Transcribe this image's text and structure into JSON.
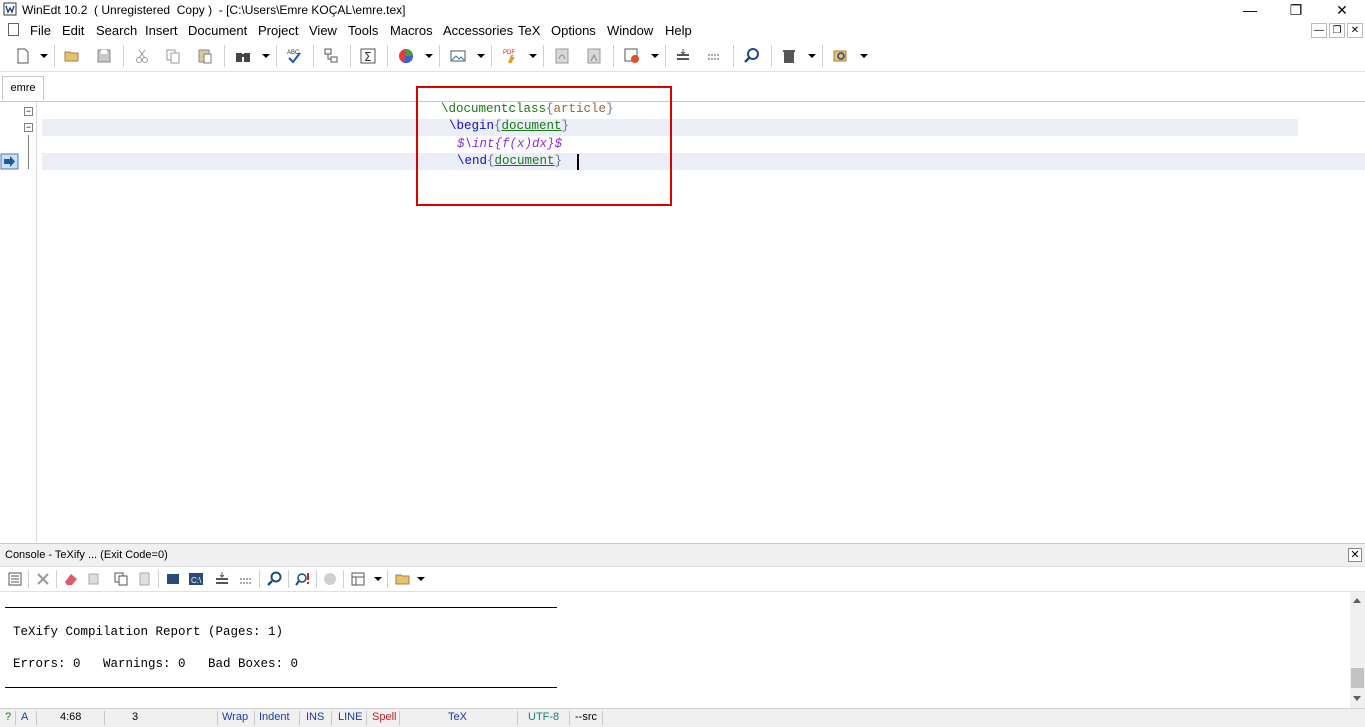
{
  "window": {
    "title": "WinEdt 10.2  ( Unregistered  Copy )  - [C:\\Users\\Emre KOÇAL\\emre.tex]",
    "minimize_glyph": "—",
    "restore_glyph": "❐",
    "close_glyph": "✕"
  },
  "menu": {
    "items": [
      "File",
      "Edit",
      "Search",
      "Insert",
      "Document",
      "Project",
      "View",
      "Tools",
      "Macros",
      "Accessories",
      "TeX",
      "Options",
      "Window",
      "Help"
    ],
    "mdi_minimize": "—",
    "mdi_restore": "❐",
    "mdi_close": "✕"
  },
  "tabs": [
    {
      "label": "emre",
      "active": true
    }
  ],
  "editor": {
    "lines": [
      {
        "cmd": "\\documentclass",
        "open": "{",
        "arg": "article",
        "close": "}"
      },
      {
        "cmd": "\\begin",
        "open": "{",
        "arg": "document",
        "close": "}"
      },
      {
        "math": "$\\int{f(x)dx}$"
      },
      {
        "cmd": "\\end",
        "open": "{",
        "arg": "document",
        "close": "}"
      }
    ],
    "fold_glyph": "−",
    "highlight_color": "#ebedf7",
    "annotation_color": "#e00000"
  },
  "console": {
    "title": "Console - TeXify ... (Exit Code=0)",
    "close_glyph": "✕",
    "report_title": "TeXify Compilation Report (Pages: 1)",
    "summary": "Errors: 0   Warnings: 0   Bad Boxes: 0"
  },
  "statusbar": {
    "help": "?",
    "mode": "A",
    "position": "4:68",
    "lines": "3",
    "wrap": "Wrap",
    "indent": "Indent",
    "ins": "INS",
    "line": "LINE",
    "spell": "Spell",
    "tex": "TeX",
    "encoding": "UTF-8",
    "src": "--src"
  }
}
